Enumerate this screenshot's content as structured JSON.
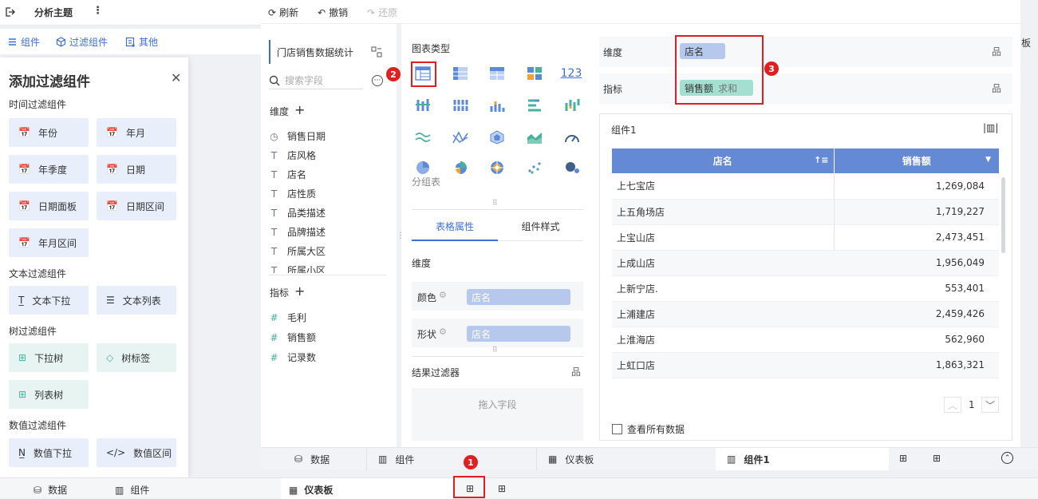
{
  "app": {
    "title": "分析主题",
    "toolbar": {
      "component": "组件",
      "filter": "过滤组件",
      "other": "其他"
    }
  },
  "filter_panel": {
    "title": "添加过滤组件",
    "sections": [
      {
        "title": "时间过滤组件",
        "items": [
          "年份",
          "年月",
          "年季度",
          "日期",
          "日期面板",
          "日期区间",
          "年月区间"
        ]
      },
      {
        "title": "文本过滤组件",
        "items": [
          "文本下拉",
          "文本列表"
        ]
      },
      {
        "title": "树过滤组件",
        "items": [
          "下拉树",
          "树标签",
          "列表树"
        ]
      },
      {
        "title": "数值过滤组件",
        "items": [
          "数值下拉",
          "数值区间"
        ]
      }
    ]
  },
  "editor": {
    "toolbar": {
      "refresh": "刷新",
      "undo": "撤销",
      "redo": "还原"
    },
    "dataset_name": "门店销售数据统计",
    "search_placeholder": "搜索字段",
    "dimension_label": "维度",
    "dimensions": [
      "销售日期",
      "店风格",
      "店名",
      "店性质",
      "品类描述",
      "品牌描述",
      "所属大区",
      "所属小区"
    ],
    "measure_label": "指标",
    "measures": [
      "毛利",
      "销售额",
      "记录数"
    ],
    "chart_type_title": "图表类型",
    "chart_type_selected": "分组表",
    "number_icon": "123",
    "prop_tabs": [
      "表格属性",
      "组件样式"
    ],
    "prop_dimension": "维度",
    "color_label": "颜色",
    "shape_label": "形状",
    "prop_field": "店名",
    "result_filter": "结果过滤器",
    "drop_hint": "拖入字段",
    "dim_row_label": "维度",
    "dim_pill": "店名",
    "measure_row_label": "指标",
    "measure_pill": "销售额",
    "measure_agg": "求和",
    "widget_title": "组件1",
    "table": {
      "headers": [
        "店名",
        "销售额"
      ],
      "rows": [
        [
          "上七宝店",
          "1,269,084"
        ],
        [
          "上五角场店",
          "1,719,227"
        ],
        [
          "上宝山店",
          "2,473,451"
        ],
        [
          "上成山店",
          "1,956,049"
        ],
        [
          "上新宁店.",
          "553,401"
        ],
        [
          "上浦建店",
          "2,459,426"
        ],
        [
          "上淮海店",
          "562,960"
        ],
        [
          "上虹口店",
          "1,863,321"
        ]
      ]
    },
    "page_number": "1",
    "view_all": "查看所有数据",
    "tabs": [
      "数据",
      "组件",
      "仪表板",
      "组件1"
    ]
  },
  "bottom_tabs": [
    "数据",
    "组件",
    "仪表板"
  ],
  "badges": [
    "1",
    "2",
    "3"
  ],
  "colors": {
    "accent": "#3d6fd6",
    "header": "#6489d5",
    "marker": "#e02020"
  },
  "side_marker": "板"
}
